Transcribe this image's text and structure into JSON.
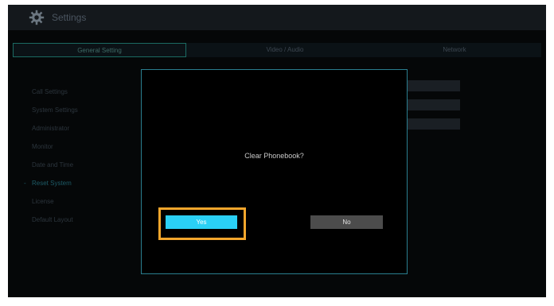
{
  "app": {
    "title": "Settings",
    "icon": "gear-icon"
  },
  "tabs": [
    {
      "label": "General Setting",
      "active": true
    },
    {
      "label": "Video / Audio",
      "active": false
    },
    {
      "label": "Network",
      "active": false
    }
  ],
  "menu": {
    "selected_marker": "-",
    "items": [
      {
        "label": "Call Settings"
      },
      {
        "label": "System Settings"
      },
      {
        "label": "Administrator"
      },
      {
        "label": "Monitor"
      },
      {
        "label": "Date and Time"
      },
      {
        "label": "Reset System",
        "selected": true
      },
      {
        "label": "License"
      },
      {
        "label": "Default Layout"
      }
    ]
  },
  "dialog": {
    "message": "Clear Phonebook?",
    "yes_label": "Yes",
    "no_label": "No"
  },
  "colors": {
    "accent": "#2ad0f5",
    "highlight": "#f4a62c",
    "dialog_border": "#2a7e8f"
  }
}
